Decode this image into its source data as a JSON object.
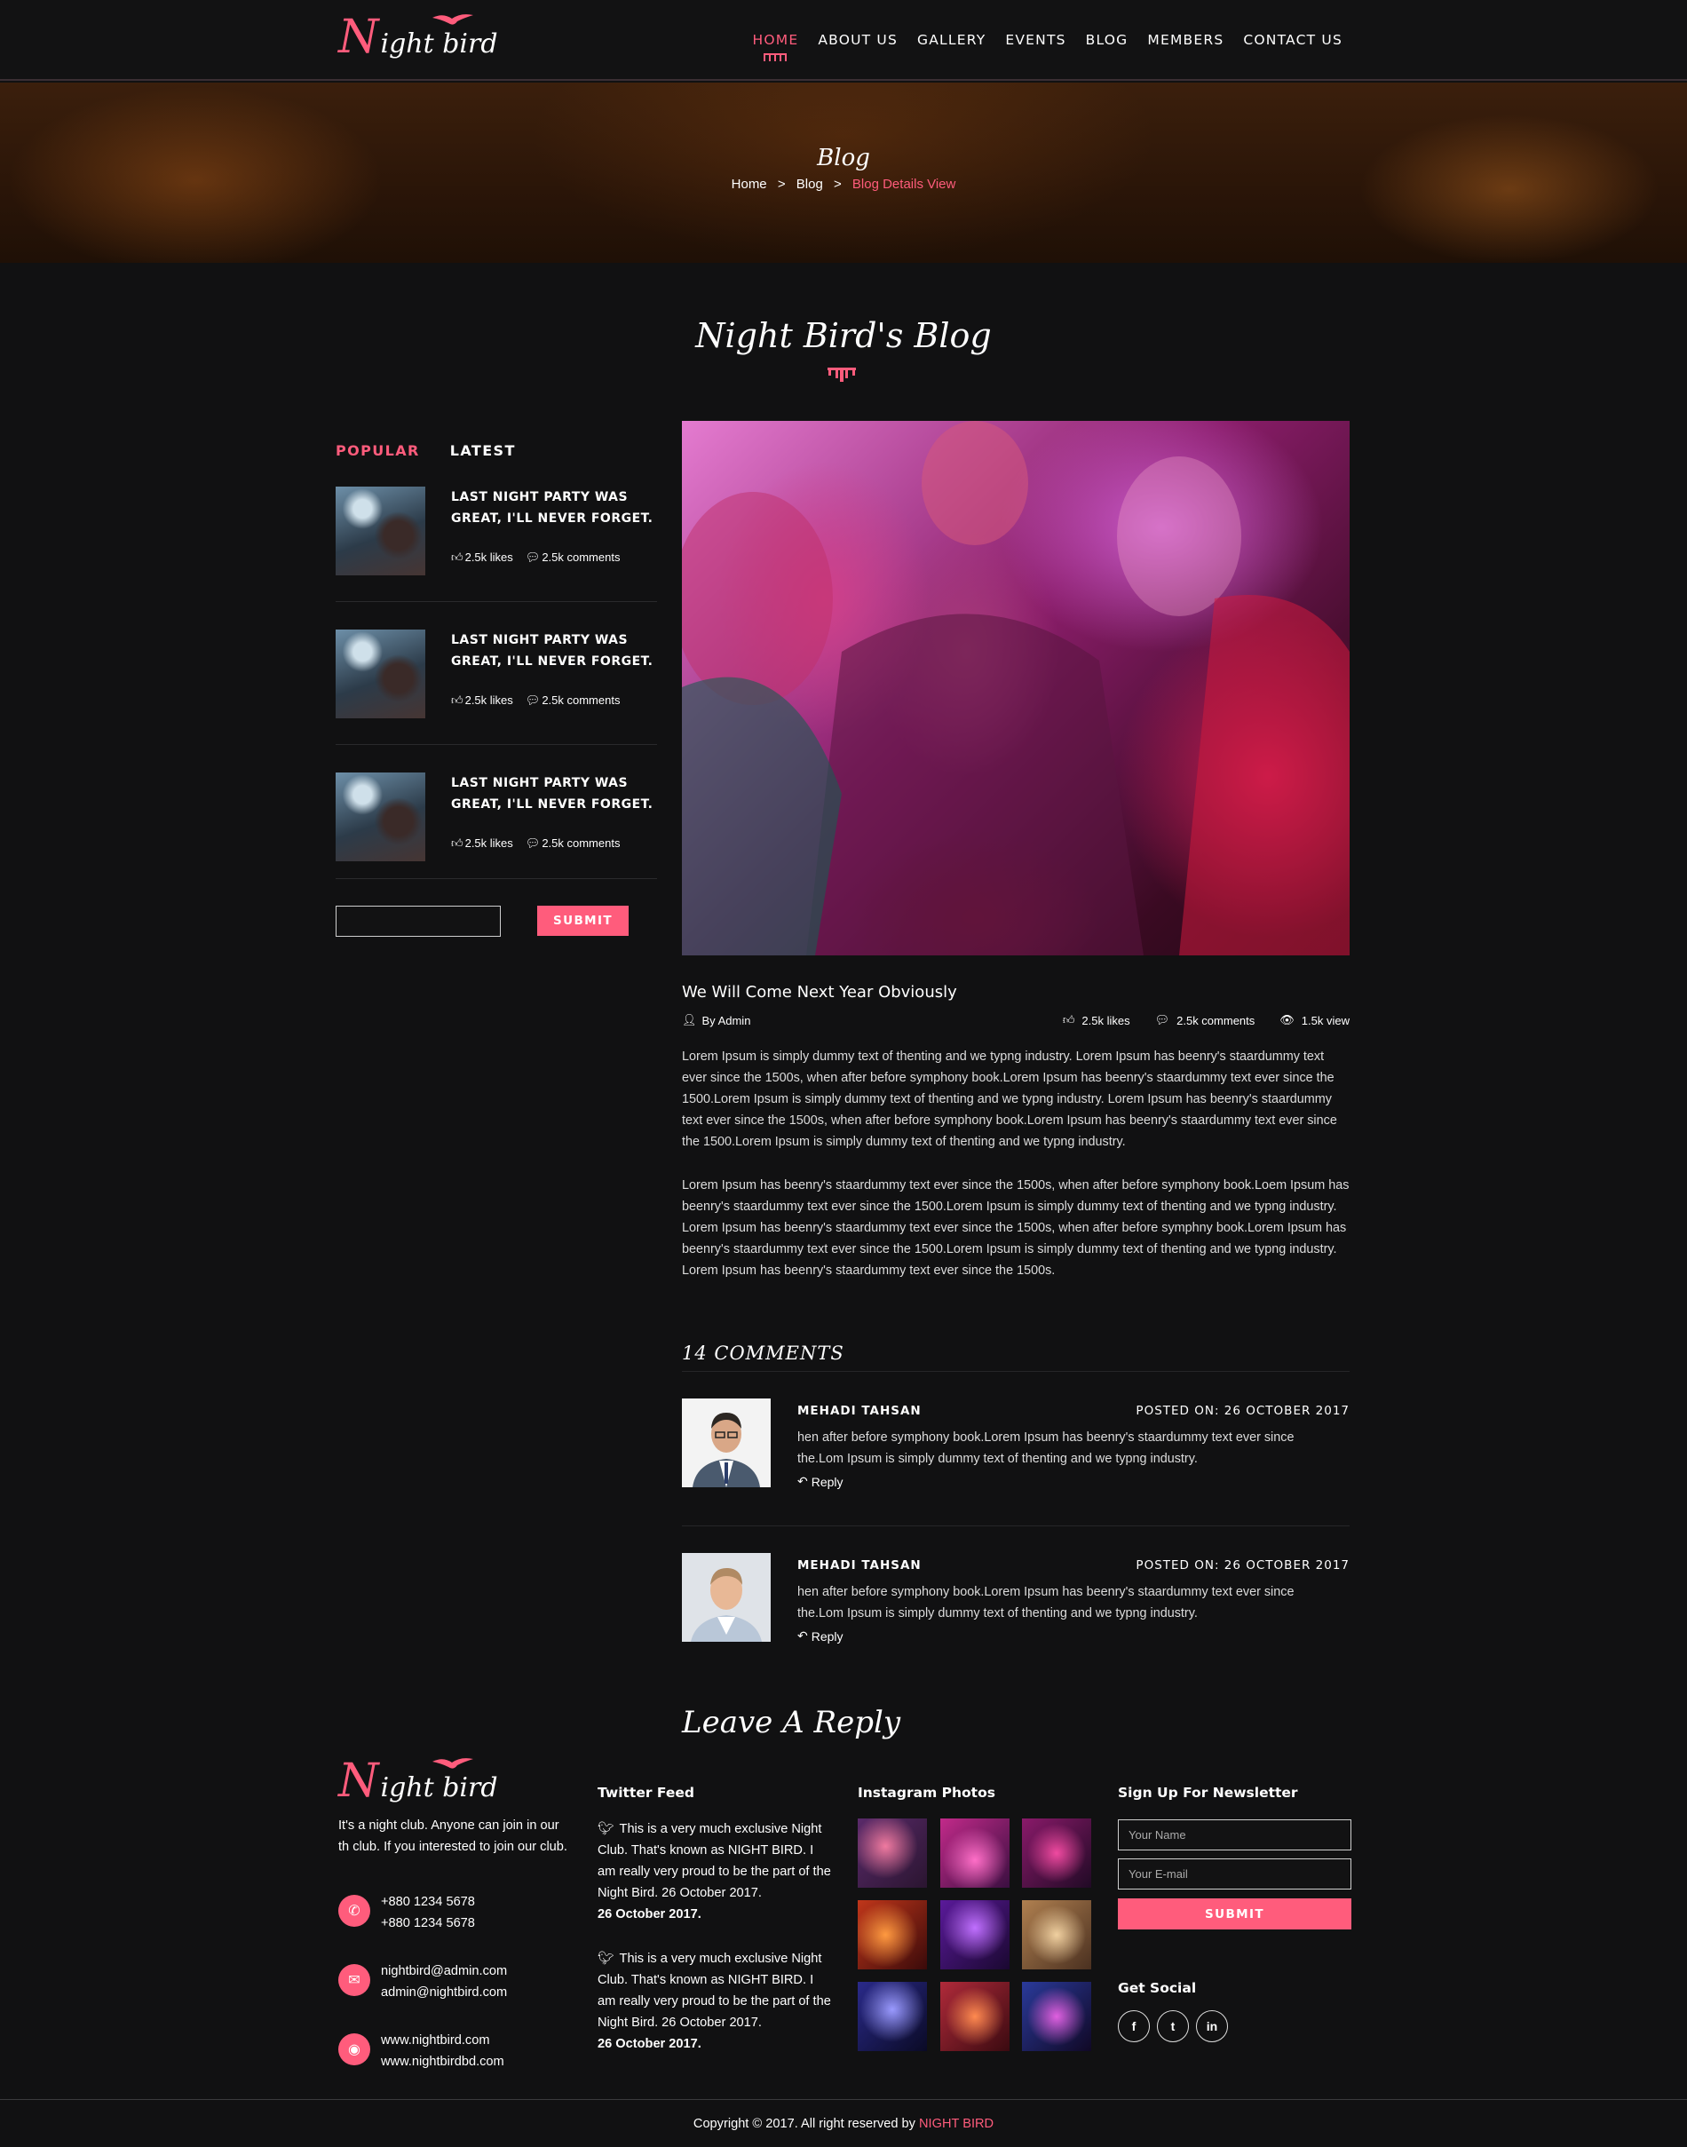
{
  "header": {
    "logo": {
      "initial": "N",
      "rest": "ight bird"
    },
    "nav": [
      "HOME",
      "ABOUT US",
      "GALLERY",
      "EVENTS",
      "BLOG",
      "MEMBERS",
      "CONTACT US"
    ]
  },
  "banner": {
    "title": "Blog",
    "breadcrumb": {
      "home": "Home",
      "sep": ">",
      "blog": "Blog",
      "current": "Blog Details View"
    }
  },
  "section_title": "Night Bird's Blog",
  "sidebar": {
    "tabs": [
      "POPULAR",
      "LATEST"
    ],
    "posts": [
      {
        "title": "LAST NIGHT PARTY WAS GREAT, I'LL NEVER FORGET.",
        "likes": "2.5k likes",
        "comments": "2.5k comments"
      },
      {
        "title": "LAST NIGHT PARTY WAS GREAT, I'LL NEVER FORGET.",
        "likes": "2.5k likes",
        "comments": "2.5k comments"
      },
      {
        "title": "LAST NIGHT PARTY WAS GREAT, I'LL NEVER FORGET.",
        "likes": "2.5k likes",
        "comments": "2.5k comments"
      }
    ],
    "submit_label": "SUBMIT"
  },
  "post": {
    "title": "We Will Come Next Year Obviously",
    "author": "By Admin",
    "likes": "2.5k likes",
    "comments": "2.5k comments",
    "views": "1.5k view",
    "paragraphs": [
      "Lorem Ipsum is simply dummy text of thenting and we typng industry. Lorem Ipsum has beenry's staardummy text ever since the 1500s, when after before symphony book.Lorem Ipsum has beenry's staardummy text ever since the 1500.Lorem Ipsum is simply dummy text of thenting and we typng industry. Lorem Ipsum has beenry's staardummy text ever since the 1500s, when after before symphony book.Lorem Ipsum has beenry's staardummy text ever since the 1500.Lorem Ipsum is simply dummy text of thenting and we typng industry.",
      "Lorem Ipsum has beenry's staardummy text ever since the 1500s, when after before symphony book.Loem Ipsum has beenry's staardummy text ever since the 1500.Lorem Ipsum is simply dummy text of thenting and we typng industry. Lorem Ipsum has beenry's staardummy text ever since the 1500s, when after before symphny book.Lorem Ipsum has beenry's staardummy text ever since the 1500.Lorem Ipsum is simply dummy text of thenting and we typng industry. Lorem Ipsum has beenry's staardummy text ever since the 1500s."
    ]
  },
  "comments": {
    "title": "14 COMMENTS",
    "items": [
      {
        "name": "MEHADI TAHSAN",
        "date": "POSTED ON: 26 OCTOBER 2017",
        "text": "hen after before symphony book.Lorem Ipsum has beenry's staardummy text ever since the.Lom Ipsum is simply dummy text of thenting and we typng industry.",
        "reply": "Reply"
      },
      {
        "name": "MEHADI TAHSAN",
        "date": "POSTED ON: 26 OCTOBER 2017",
        "text": "hen after before symphony book.Lorem Ipsum has beenry's staardummy text ever since the.Lom Ipsum is simply dummy text of thenting and we typng industry.",
        "reply": "Reply"
      }
    ]
  },
  "leave_reply": "Leave A Reply",
  "footer": {
    "about": "It's a night club. Anyone can join in our th club. If you interested to join our club.",
    "phones": [
      "+880 1234 5678",
      "+880 1234 5678"
    ],
    "emails": [
      "nightbird@admin.com",
      "admin@nightbird.com"
    ],
    "sites": [
      "www.nightbird.com",
      "www.nightbirdbd.com"
    ],
    "twitter_title": "Twitter Feed",
    "tweets": [
      {
        "text": "This is a very much exclusive Night Club. That's known as NIGHT BIRD. I am really very proud to be the part of the Night Bird. 26 October 2017.",
        "date": "26 October 2017."
      },
      {
        "text": "This is a very much exclusive Night Club. That's known as NIGHT BIRD. I am really very proud to be the part of the Night Bird. 26 October 2017.",
        "date": "26 October 2017."
      }
    ],
    "instagram_title": "Instagram Photos",
    "newsletter_title": "Sign Up For Newsletter",
    "name_placeholder": "Your Name",
    "email_placeholder": "Your E-mail",
    "submit_label": "SUBMIT",
    "social_title": "Get Social",
    "social": [
      "f",
      "t",
      "in"
    ],
    "copyright": "Copyright © 2017. All right reserved by ",
    "brand": "NIGHT BIRD"
  },
  "colors": {
    "accent": "#ff5c7c",
    "background": "#111112"
  }
}
